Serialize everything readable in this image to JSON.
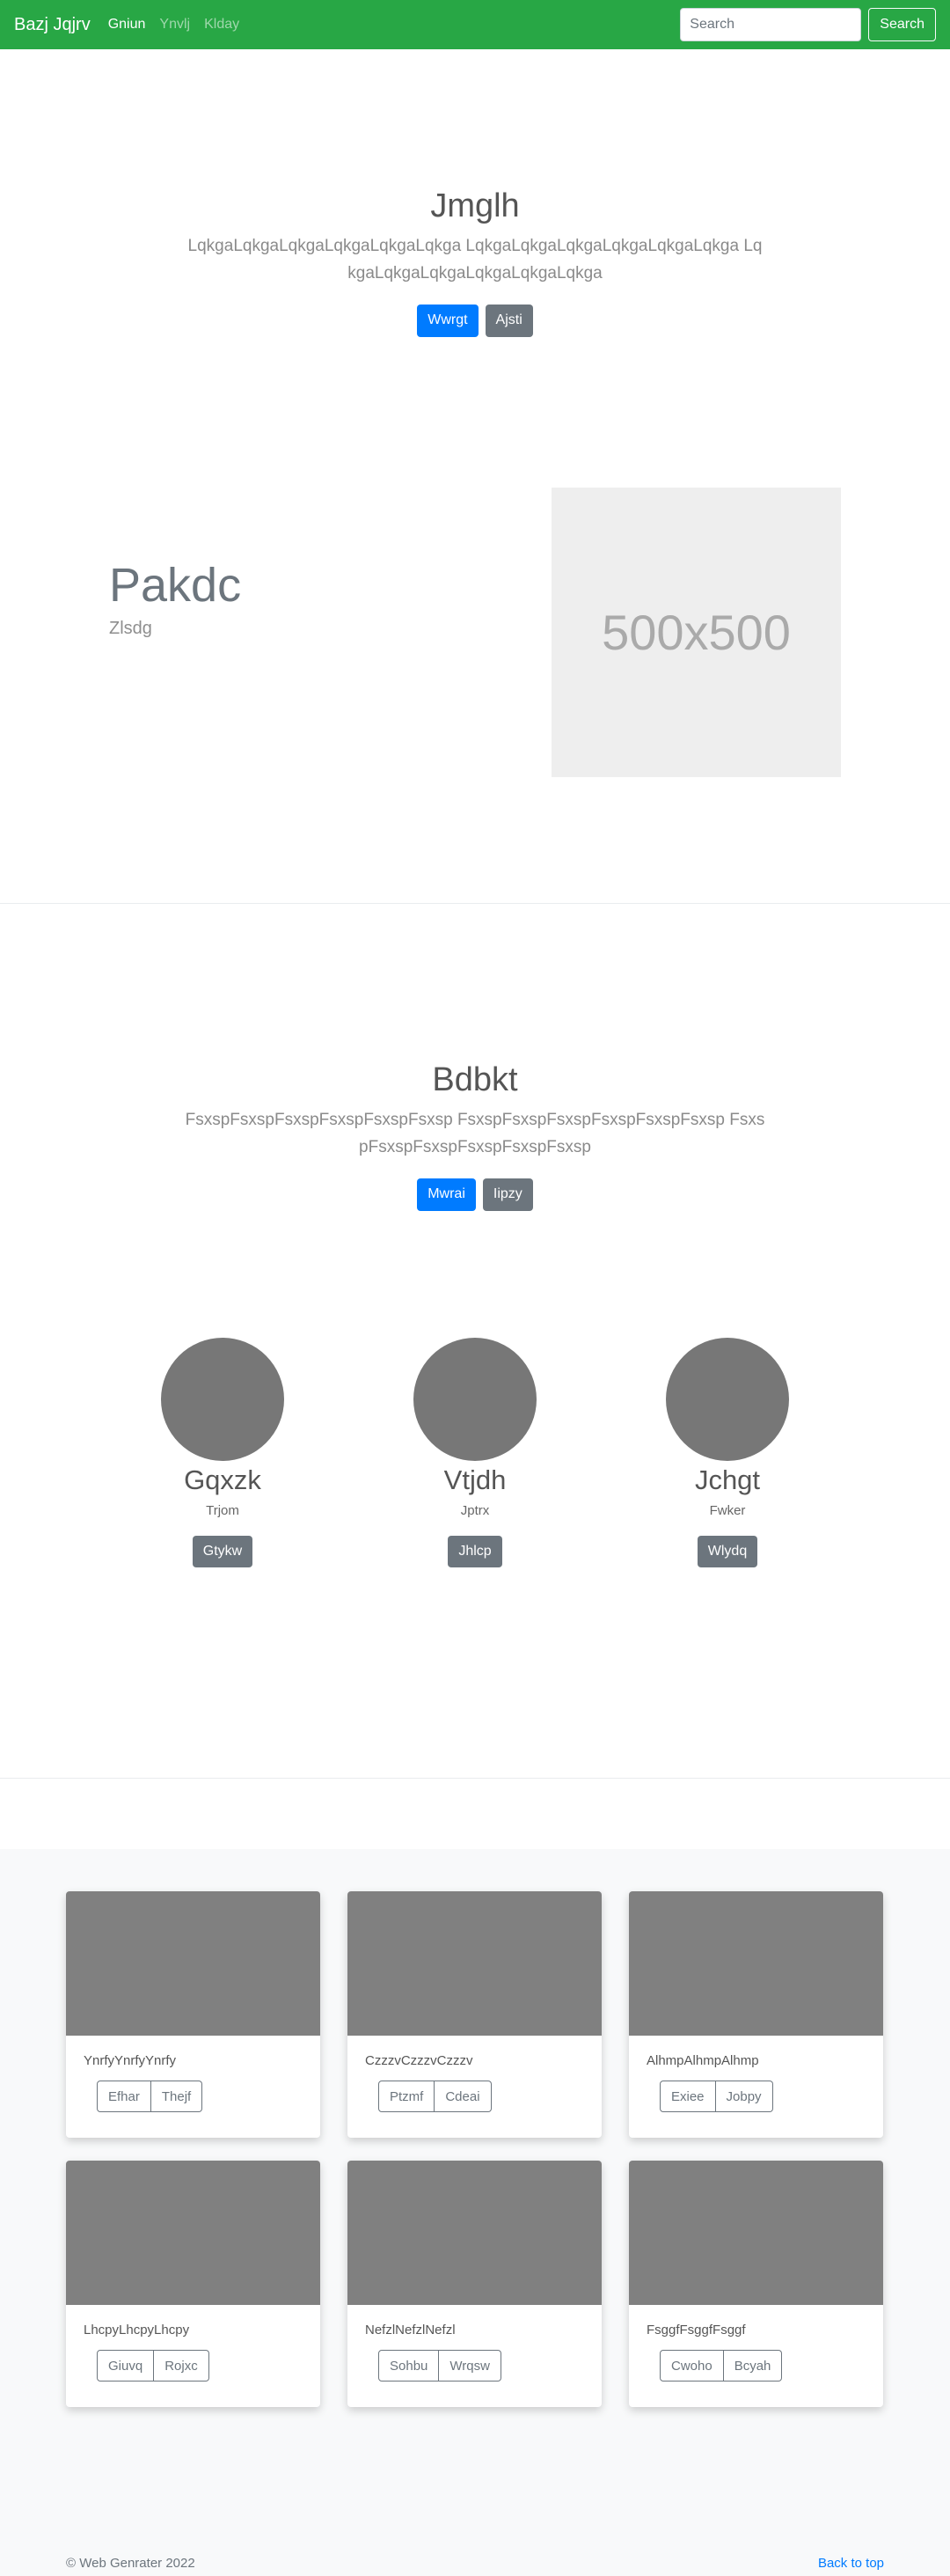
{
  "navbar": {
    "brand": "Bazj Jqjrv",
    "links": [
      {
        "label": "Gniun",
        "active": true
      },
      {
        "label": "Ynvlj",
        "active": false
      },
      {
        "label": "Klday",
        "active": false
      }
    ],
    "search_placeholder": "Search",
    "search_button": "Search"
  },
  "hero1": {
    "title": "Jmglh",
    "lead": "LqkgaLqkgaLqkgaLqkgaLqkgaLqkga LqkgaLqkgaLqkgaLqkgaLqkgaLqkga LqkgaLqkgaLqkgaLqkgaLqkgaLqkga",
    "primary": "Wwrgt",
    "secondary": "Ajsti"
  },
  "feature": {
    "heading": "Pakdc",
    "subheading": "Zlsdg",
    "image_label": "500x500"
  },
  "hero2": {
    "title": "Bdbkt",
    "lead": "FsxspFsxspFsxspFsxspFsxspFsxsp FsxspFsxspFsxspFsxspFsxspFsxsp FsxspFsxspFsxspFsxspFsxspFsxsp",
    "primary": "Mwrai",
    "secondary": "Iipzy"
  },
  "circles": [
    {
      "name": "Gqxzk",
      "sub": "Trjom",
      "button": "Gtykw"
    },
    {
      "name": "Vtjdh",
      "sub": "Jptrx",
      "button": "Jhlcp"
    },
    {
      "name": "Jchgt",
      "sub": "Fwker",
      "button": "Wlydq"
    }
  ],
  "cards": [
    {
      "text": "YnrfyYnrfyYnrfy",
      "buttons": [
        "Efhar",
        "Thejf"
      ]
    },
    {
      "text": "CzzzvCzzzvCzzzv",
      "buttons": [
        "Ptzmf",
        "Cdeai"
      ]
    },
    {
      "text": "AlhmpAlhmpAlhmp",
      "buttons": [
        "Exiee",
        "Jobpy"
      ]
    },
    {
      "text": "LhcpyLhcpyLhcpy",
      "buttons": [
        "Giuvq",
        "Rojxc"
      ]
    },
    {
      "text": "NefzlNefzlNefzl",
      "buttons": [
        "Sohbu",
        "Wrqsw"
      ]
    },
    {
      "text": "FsggfFsggfFsggf",
      "buttons": [
        "Cwoho",
        "Bcyah"
      ]
    }
  ],
  "footer": {
    "copyright": "© Web Genrater 2022",
    "back_to_top": "Back to top"
  },
  "colors": {
    "navbar": "#28a745",
    "primary": "#007bff",
    "secondary": "#6c757d"
  }
}
